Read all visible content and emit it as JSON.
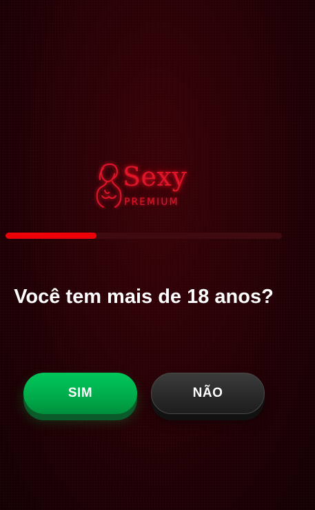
{
  "brand": {
    "name": "Sexy",
    "tagline": "PREMIUM",
    "accent_color": "#e0152a"
  },
  "progress": {
    "value": 0.33,
    "fill_color": "#ee0008"
  },
  "question": {
    "text": "Você tem mais de 18 anos?"
  },
  "buttons": {
    "yes_label": "SIM",
    "no_label": "NÃO",
    "yes_color": "#00c75a",
    "no_color": "#2a2a2a"
  }
}
